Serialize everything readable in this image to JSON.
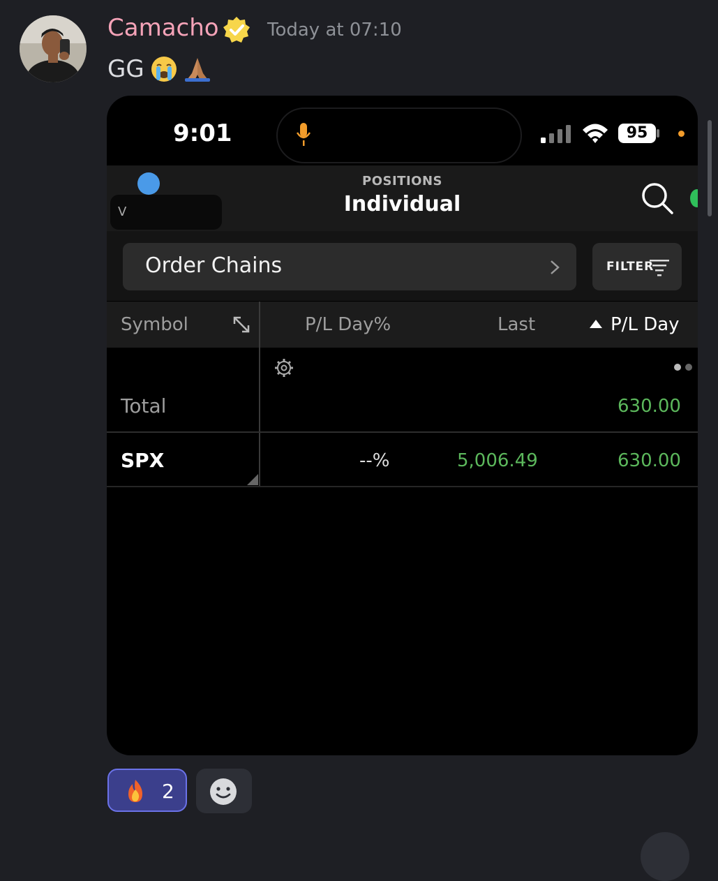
{
  "message": {
    "author": "Camacho",
    "timestamp": "Today at 07:10",
    "text": "GG",
    "emojis": [
      "loudly-crying-face-icon",
      "folded-hands-icon"
    ],
    "verified_badge": "verified-badge-icon"
  },
  "phone": {
    "status_time": "9:01",
    "battery": "95",
    "nav": {
      "subtitle": "POSITIONS",
      "title": "Individual",
      "partial_account_letter": "V"
    },
    "order_chains_label": "Order Chains",
    "filter_label": "FILTER",
    "table": {
      "columns": [
        "Symbol",
        "P/L Day%",
        "Last",
        "P/L Day"
      ],
      "sort_column": "P/L Day",
      "total_row": {
        "label": "Total",
        "pl_day": "630.00"
      },
      "rows": [
        {
          "symbol": "SPX",
          "pl_day_pct": "--%",
          "last": "5,006.49",
          "pl_day": "630.00"
        }
      ]
    }
  },
  "reactions": [
    {
      "icon": "fire-icon",
      "count": "2",
      "active": true
    }
  ],
  "colors": {
    "background": "#1e1f24",
    "username": "#f5a3b8",
    "positive": "#5cb85c",
    "reaction_active_bg": "#3b3f8c",
    "reaction_active_border": "#6b72e8"
  }
}
